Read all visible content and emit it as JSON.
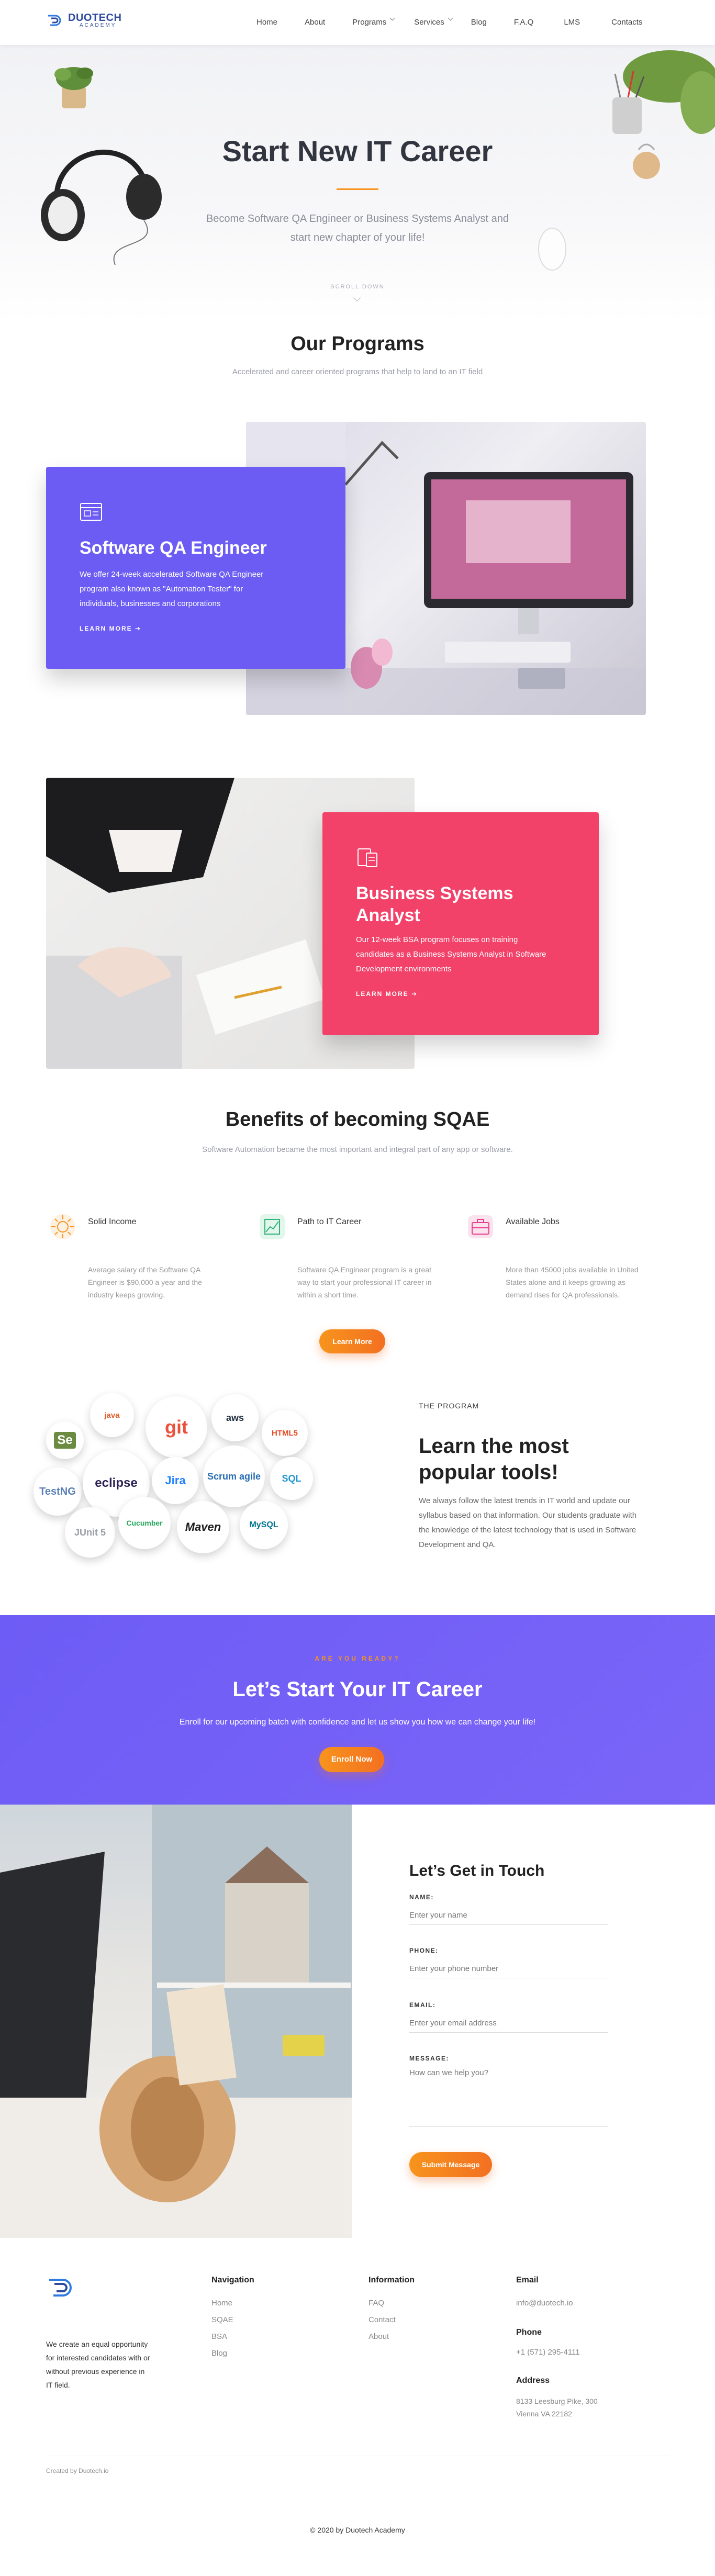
{
  "header": {
    "logo_name": "DUOTECH",
    "logo_sub": "ACADEMY",
    "nav": [
      {
        "label": "Home"
      },
      {
        "label": "About"
      },
      {
        "label": "Programs"
      },
      {
        "label": "Services"
      },
      {
        "label": "Blog"
      },
      {
        "label": "F.A.Q"
      },
      {
        "label": "LMS"
      },
      {
        "label": "Contacts"
      }
    ]
  },
  "hero": {
    "title": "Start New IT Career",
    "subtitle": "Become Software QA Engineer or Business Systems Analyst and start new chapter of your life!",
    "scroll_label": "SCROLL DOWN"
  },
  "programs": {
    "title": "Our Programs",
    "subtitle": "Accelerated and career oriented programs that help to land to an IT field",
    "items": [
      {
        "title": "Software QA Engineer",
        "text": "We offer 24-week accelerated Software QA Engineer program also known as \"Automation Tester\" for individuals, businesses and corporations",
        "link": "LEARN MORE",
        "color": "#6c5cf3"
      },
      {
        "title": "Business Systems Analyst",
        "text": "Our 12-week BSA program focuses on training candidates as a Business Systems Analyst in Software Development environments",
        "link": "LEARN MORE",
        "color": "#f2426a"
      }
    ]
  },
  "benefits": {
    "title": "Benefits of becoming SQAE",
    "subtitle": "Software Automation became the most important and integral part of any app or software.",
    "items": [
      {
        "icon": "coin-icon",
        "title": "Solid Income",
        "text": "Average salary of the Software QA Engineer is $90,000 a year and the industry keeps growing."
      },
      {
        "icon": "chart-icon",
        "title": "Path to IT Career",
        "text": "Software QA Engineer program is a great way to start your professional IT career in within a short time."
      },
      {
        "icon": "briefcase-icon",
        "title": "Available Jobs",
        "text": "More than 45000 jobs available in United States alone and it keeps growing as demand rises for QA professionals."
      }
    ],
    "button": "Learn More"
  },
  "tools": {
    "eyebrow": "THE PROGRAM",
    "title": "Learn the most popular tools!",
    "text": "We always follow the latest trends in IT world and update our syllabus based on that information. Our students graduate with the knowledge of the latest technology that is used in Software Development and QA.",
    "logos": [
      "Se",
      "java",
      "git",
      "aws",
      "HTML5",
      "TestNG",
      "eclipse",
      "Jira",
      "Scrum agile",
      "SQL",
      "JUnit 5",
      "Cucumber",
      "Maven",
      "MySQL"
    ]
  },
  "cta": {
    "eyebrow": "ARE YOU READY?",
    "title": "Let’s Start Your IT Career",
    "text": "Enroll for our upcoming batch with confidence and let us show you how we can change your life!",
    "button": "Enroll Now"
  },
  "contact": {
    "title": "Let’s Get in Touch",
    "name_label": "NAME:",
    "name_placeholder": "Enter your name",
    "phone_label": "PHONE:",
    "phone_placeholder": "Enter your phone number",
    "email_label": "EMAIL:",
    "email_placeholder": "Enter your email address",
    "message_label": "MESSAGE:",
    "message_placeholder": "How can we help you?",
    "button": "Submit Message"
  },
  "footer": {
    "about": "We create an equal opportunity for interested candidates with or without previous experience in IT field.",
    "nav_title": "Navigation",
    "nav_links": [
      "Home",
      "SQAE",
      "BSA",
      "Blog"
    ],
    "info_title": "Information",
    "info_links": [
      "FAQ",
      "Contact",
      "About"
    ],
    "email_title": "Email",
    "email": "info@duotech.io",
    "phone_title": "Phone",
    "phone": "+1 (571) 295-4111",
    "address_title": "Address",
    "address": "8133 Leesburg Pike, 300 Vienna VA 22182",
    "created_by": "Created by Duotech.io",
    "copyright": "© 2020 by Duotech Academy"
  }
}
